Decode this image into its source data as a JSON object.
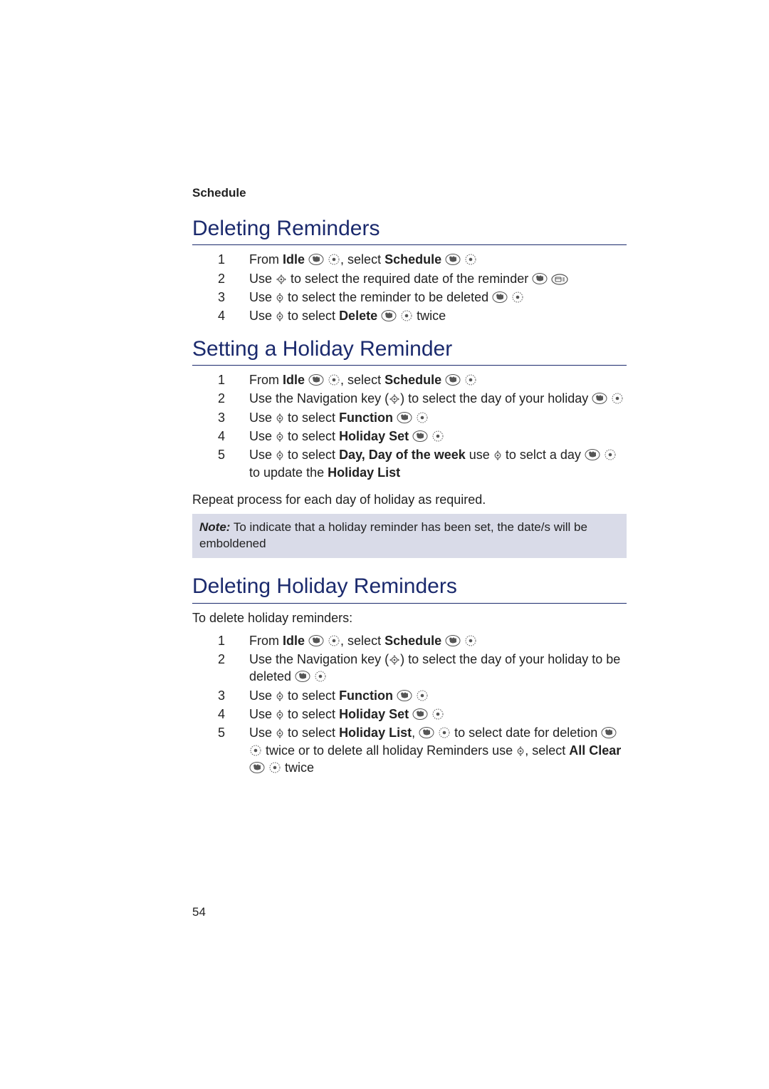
{
  "sectionLabel": "Schedule",
  "pageNumber": "54",
  "strings": {
    "from": "From ",
    "idle": "Idle",
    "select": ", select ",
    "schedule": "Schedule",
    "useNav": "Use ",
    "useNavKey": "Use the Navigation key (",
    "useNavKeyClose": ") to select the day of your holiday ",
    "useNavKeyCloseDel": ") to select the day of your holiday to be deleted ",
    "toSelectReqDate": " to select the required date of the reminder ",
    "toSelectReminderDel": " to select the reminder to be deleted ",
    "toSelect": " to select ",
    "delete": "Delete",
    "twice": " twice",
    "function": "Function",
    "holidaySet": "Holiday Set",
    "dayDow": "Day, Day of the week",
    "use": " use ",
    "toSelctDay": " to selct a day ",
    "toUpdate": " to update the ",
    "holidayList": "Holiday List",
    "repeat": "Repeat process for each day of holiday as required.",
    "noteLabel": "Note:",
    "noteBody": " To indicate that a holiday reminder has been set, the date/s will be emboldened",
    "toDelete": "To delete holiday reminders:",
    "holidayListComma": "Holiday List",
    "comma": ", ",
    "toSelectDateDel": " to select date for deletion ",
    "twiceOrDelAll": " twice or to delete all holiday Reminders use ",
    "selectAll": ", select ",
    "allClear": "All Clear"
  },
  "headings": {
    "h1": "Deleting Reminders",
    "h2": "Setting a Holiday Reminder",
    "h3": "Deleting Holiday Reminders"
  }
}
